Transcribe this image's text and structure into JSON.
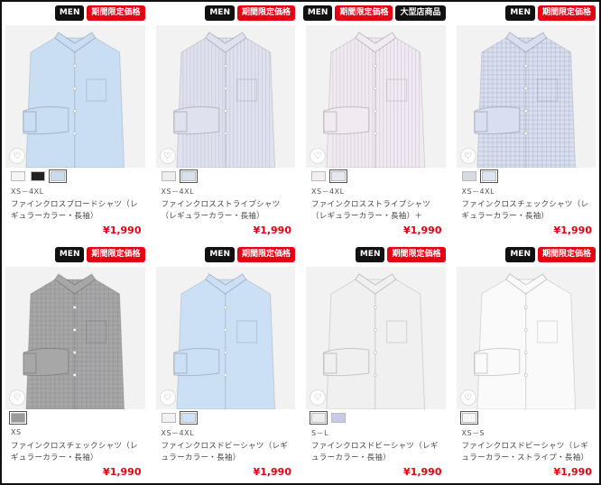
{
  "products": [
    {
      "badges": [
        "MEN",
        "期間限定価格"
      ],
      "colors": [
        "#f5f5f5",
        "#222222",
        "#c7dcf1"
      ],
      "selected": 2,
      "shirt": "#c9ddf3",
      "pattern": "plain",
      "size": "XS－4XL",
      "name": "ファインクロスブロードシャツ（レギュラーカラー・長袖）",
      "price": "¥1,990"
    },
    {
      "badges": [
        "MEN",
        "期間限定価格"
      ],
      "colors": [
        "#eeeeee",
        "#dbe0ee"
      ],
      "selected": 1,
      "shirt": "#dfe2ee",
      "pattern": "stripe",
      "size": "XS－4XL",
      "name": "ファインクロスストライプシャツ（レギュラーカラー・長袖）",
      "price": "¥1,990"
    },
    {
      "badges": [
        "MEN",
        "期間限定価格",
        "大型店商品"
      ],
      "colors": [
        "#f3eef2",
        "#e6e7ef"
      ],
      "selected": 1,
      "shirt": "#f1eaf0",
      "pattern": "stripe",
      "size": "XS－4XL",
      "name": "ファインクロスストライプシャツ（レギュラーカラー・長袖）＋",
      "price": "¥1,990"
    },
    {
      "badges": [
        "MEN",
        "期間限定価格"
      ],
      "colors": [
        "#d8dbe4",
        "#dde5f2"
      ],
      "selected": 1,
      "shirt": "#d7dff0",
      "pattern": "check",
      "size": "XS－4XL",
      "name": "ファインクロスチェックシャツ（レギュラーカラー・長袖）",
      "price": "¥1,990"
    },
    {
      "badges": [
        "MEN",
        "期間限定価格"
      ],
      "colors": [
        "#9a9a9a"
      ],
      "selected": 0,
      "shirt": "#a7a7a7",
      "pattern": "check",
      "size": "XS",
      "name": "ファインクロスチェックシャツ（レギュラーカラー・長袖）",
      "price": "¥1,990"
    },
    {
      "badges": [
        "MEN",
        "期間限定価格"
      ],
      "colors": [
        "#f2f2f2",
        "#cfe1f5"
      ],
      "selected": 1,
      "shirt": "#cbe0f5",
      "pattern": "plain",
      "size": "XS－4XL",
      "name": "ファインクロスドビーシャツ（レギュラーカラー・長袖）",
      "price": "¥1,990"
    },
    {
      "badges": [
        "MEN",
        "期間限定価格"
      ],
      "colors": [
        "#eeeeee",
        "#c8cae8"
      ],
      "selected": 0,
      "shirt": "#f0f0f0",
      "pattern": "plain",
      "size": "S－L",
      "name": "ファインクロスドビーシャツ（レギュラーカラー・長袖）",
      "price": "¥1,990"
    },
    {
      "badges": [
        "MEN",
        "期間限定価格"
      ],
      "colors": [
        "#f7f7f7"
      ],
      "selected": 0,
      "shirt": "#fafafa",
      "pattern": "plain",
      "size": "XS－S",
      "name": "ファインクロスドビーシャツ（レギュラーカラー・ストライプ・長袖）",
      "price": "¥1,990"
    }
  ]
}
